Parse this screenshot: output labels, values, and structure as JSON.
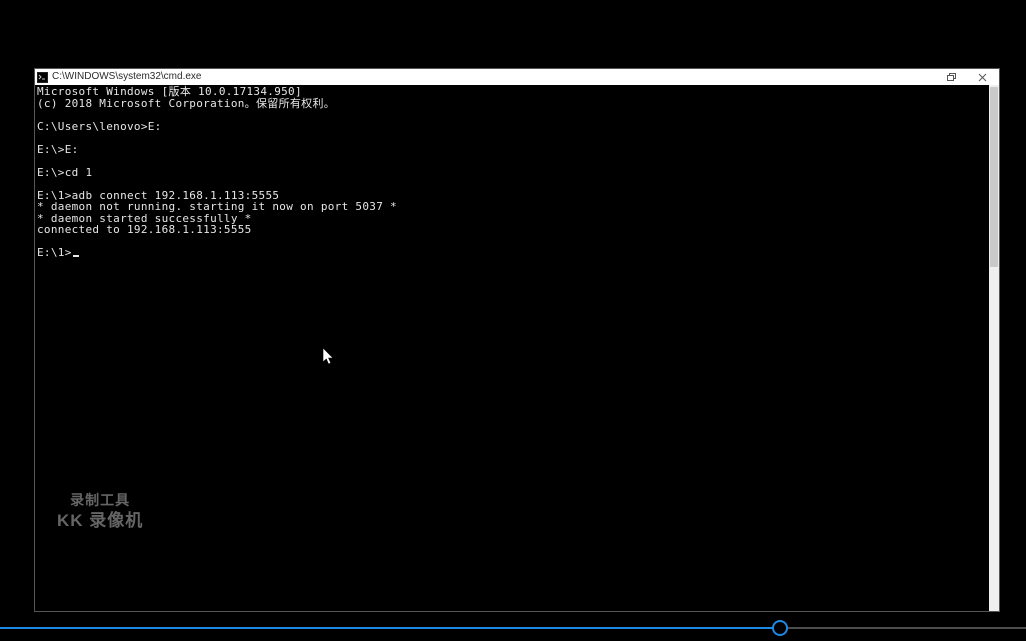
{
  "window": {
    "title": "C:\\WINDOWS\\system32\\cmd.exe"
  },
  "terminal": {
    "lines": [
      "Microsoft Windows [版本 10.0.17134.950]",
      "(c) 2018 Microsoft Corporation。保留所有权利。",
      "",
      "C:\\Users\\lenovo>E:",
      "",
      "E:\\>E:",
      "",
      "E:\\>cd 1",
      "",
      "E:\\1>adb connect 192.168.1.113:5555",
      "* daemon not running. starting it now on port 5037 *",
      "* daemon started successfully *",
      "connected to 192.168.1.113:5555",
      "",
      "E:\\1>"
    ],
    "prompt_cursor_line_index": 14
  },
  "watermark": {
    "line1": "录制工具",
    "line2": "KK 录像机"
  },
  "player": {
    "progress_percent": 76
  }
}
